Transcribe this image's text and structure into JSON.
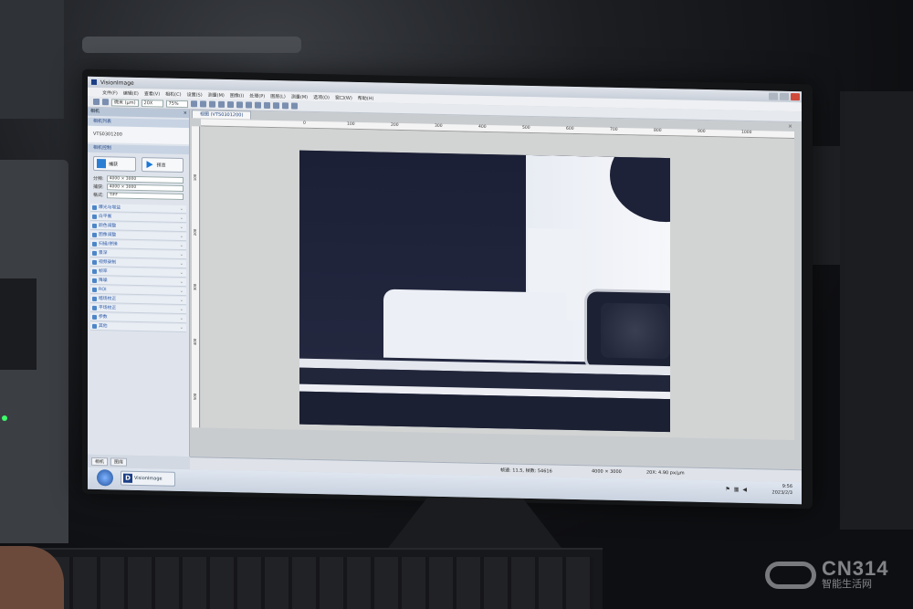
{
  "window": {
    "title": "VisionImage"
  },
  "menu": [
    "文件(F)",
    "编辑(E)",
    "查看(V)",
    "相机(C)",
    "设置(S)",
    "测量(M)",
    "图像(I)",
    "处理(P)",
    "图层(L)",
    "测量(M)",
    "选项(O)",
    "窗口(W)",
    "帮助(H)"
  ],
  "toolbar": {
    "unit": "微米 (μm)",
    "magnification": "20X",
    "zoom": "75%"
  },
  "panel": {
    "header": "相机",
    "camera_section": "相机列表",
    "camera_id": "VTS0301200",
    "control_section": "相机控制",
    "capture_label": "捕获",
    "preview_label": "预览",
    "params": [
      {
        "label": "分辨:",
        "value": "4000 × 3000"
      },
      {
        "label": "捕获:",
        "value": "4000 × 3000"
      },
      {
        "label": "格式:",
        "value": "TIFF"
      }
    ],
    "items": [
      "曝光与增益",
      "白平衡",
      "颜色调整",
      "图像调整",
      "扫描/拼接",
      "景深",
      "视频录制",
      "帧率",
      "降噪",
      "ROI",
      "暗场校正",
      "平场校正",
      "参数",
      "其他"
    ],
    "foot_tabs": [
      "相机",
      "图库"
    ]
  },
  "document": {
    "tab_label": "视图 (VTS0301200)",
    "ruler_top": [
      "0",
      "100",
      "200",
      "300",
      "400",
      "500",
      "600",
      "700",
      "800",
      "900",
      "1000"
    ],
    "ruler_left": [
      "100",
      "200",
      "300",
      "400",
      "500"
    ]
  },
  "status": {
    "frame_rate": "帧速: 11.5, 帧数: 54616",
    "resolution": "4000 × 3000",
    "scale": "20X: 4.90 px/μm"
  },
  "taskbar": {
    "app_label": "VisionImage",
    "time": "9:56",
    "date": "2023/2/3"
  },
  "watermark": {
    "brand": "CN314",
    "sub": "智能生活网"
  }
}
